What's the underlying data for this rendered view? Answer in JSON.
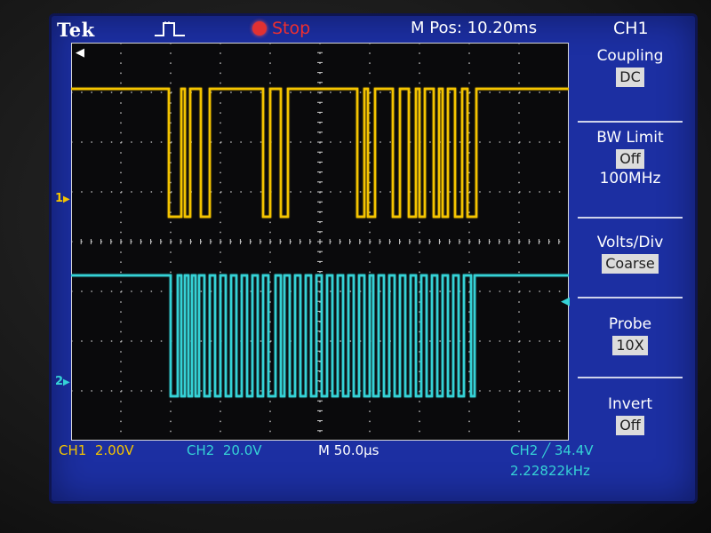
{
  "header": {
    "brand": "Tek",
    "trigger_icon": "trigger-pulse-icon",
    "status": "Stop",
    "status_color": "#e23131",
    "mpos": "M Pos: 10.20ms",
    "channel_title": "CH1"
  },
  "markers": {
    "ch1": "1",
    "ch2": "2"
  },
  "menu": {
    "items": [
      {
        "title": "Coupling",
        "value": "DC"
      },
      {
        "title": "BW Limit",
        "value": "Off",
        "extra": "100MHz"
      },
      {
        "title": "Volts/Div",
        "value": "Coarse"
      },
      {
        "title": "Probe",
        "value": "10X"
      },
      {
        "title": "Invert",
        "value": "Off"
      }
    ]
  },
  "readout": {
    "ch1_label": "CH1",
    "ch1_scale": "2.00V",
    "ch2_label": "CH2",
    "ch2_scale": "20.0V",
    "time_label": "M",
    "time_scale": "50.0µs",
    "trig_source": "CH2",
    "trig_slope": "╱",
    "trig_level": "34.4V",
    "frequency": "2.22822kHz"
  },
  "colors": {
    "ch1": "#f4c400",
    "ch2": "#35d2d6",
    "screen": "#1c2fa2",
    "graticule": "#0a0a0c"
  }
}
